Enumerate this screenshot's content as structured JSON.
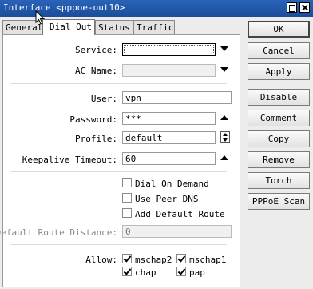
{
  "window": {
    "title": "Interface <pppoe-out10>"
  },
  "tabs": [
    "General",
    "Dial Out",
    "Status",
    "Traffic"
  ],
  "form": {
    "service": {
      "label": "Service:",
      "value": ""
    },
    "ac_name": {
      "label": "AC Name:",
      "value": ""
    },
    "user": {
      "label": "User:",
      "value": "vpn"
    },
    "password": {
      "label": "Password:",
      "value": "***"
    },
    "profile": {
      "label": "Profile:",
      "value": "default"
    },
    "keepalive": {
      "label": "Keepalive Timeout:",
      "value": "60"
    },
    "dial_on_demand": {
      "label": "Dial On Demand",
      "checked": false
    },
    "use_peer_dns": {
      "label": "Use Peer DNS",
      "checked": false
    },
    "add_default_route": {
      "label": "Add Default Route",
      "checked": false
    },
    "default_route_distance": {
      "label": "Default Route Distance:",
      "value": "0"
    },
    "allow": {
      "label": "Allow:",
      "options": [
        {
          "label": "mschap2",
          "checked": true
        },
        {
          "label": "mschap1",
          "checked": true
        },
        {
          "label": "chap",
          "checked": true
        },
        {
          "label": "pap",
          "checked": true
        }
      ]
    }
  },
  "buttons": [
    "OK",
    "Cancel",
    "Apply",
    "Disable",
    "Comment",
    "Copy",
    "Remove",
    "Torch",
    "PPPoE Scan"
  ]
}
